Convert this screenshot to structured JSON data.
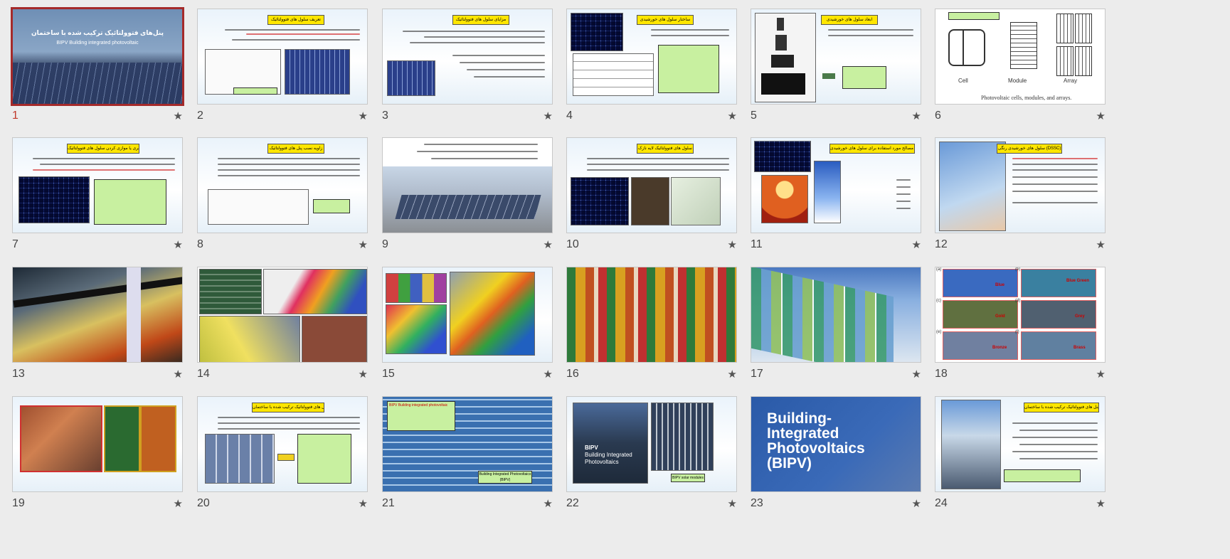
{
  "selected_slide": 1,
  "star_glyph": "★",
  "slides": [
    {
      "number": "1",
      "title": "پنل‌های فتوولتائیک ترکیب شده با ساختمان",
      "subtitle": "BIPV Building integrated photovoltaic"
    },
    {
      "number": "2",
      "title": "تعریف سلول های فتوولتائیک"
    },
    {
      "number": "3",
      "title": "مزایای سلول های فتوولتائیک"
    },
    {
      "number": "4",
      "title": "ساختار سلول های خورشیدی"
    },
    {
      "number": "5",
      "title": "ابعاد سلول های خورشیدی"
    },
    {
      "number": "6",
      "labels": [
        "Cell",
        "Module",
        "Array"
      ],
      "caption": "Photovoltaic cells, modules, and arrays."
    },
    {
      "number": "7",
      "title": "سری یا موازی کردن سلول های فتوولتائیک"
    },
    {
      "number": "8",
      "title": "زاویه نصب پنل های فتوولتائیک"
    },
    {
      "number": "9"
    },
    {
      "number": "10",
      "title": "سلول های فتوولتائیک لایه نازک"
    },
    {
      "number": "11",
      "title": "انواع مصالح مورد استفاده برای سلول های خورشیدی"
    },
    {
      "number": "12",
      "title": "سلول های خورشیدی رنگی (DSSC)"
    },
    {
      "number": "13"
    },
    {
      "number": "14"
    },
    {
      "number": "15"
    },
    {
      "number": "16"
    },
    {
      "number": "17"
    },
    {
      "number": "18",
      "tags": [
        "(a)",
        "(b)",
        "(c)",
        "(d)",
        "(e)",
        "(f)"
      ],
      "colors": [
        "Blue",
        "Blue Green",
        "Gold",
        "Grey",
        "Bronze",
        "Brass"
      ]
    },
    {
      "number": "19"
    },
    {
      "number": "20",
      "title": "پنل های فتوولتائیک ترکیب شده با ساختمان"
    },
    {
      "number": "21",
      "box": "BIPV Building integrated photovoltaic",
      "tag": "Building Integrated Photovoltaics (BIPV)"
    },
    {
      "number": "22",
      "sign": [
        "BIPV",
        "Building Integrated",
        "Photovoltaics"
      ],
      "tag": "BIPV solar modules"
    },
    {
      "number": "23",
      "text": [
        "Building-",
        "Integrated",
        "Photovoltaics",
        "(BIPV)"
      ]
    },
    {
      "number": "24",
      "title": "مزایای پنل های فتوولتائیک ترکیب شده با ساختمان"
    }
  ]
}
